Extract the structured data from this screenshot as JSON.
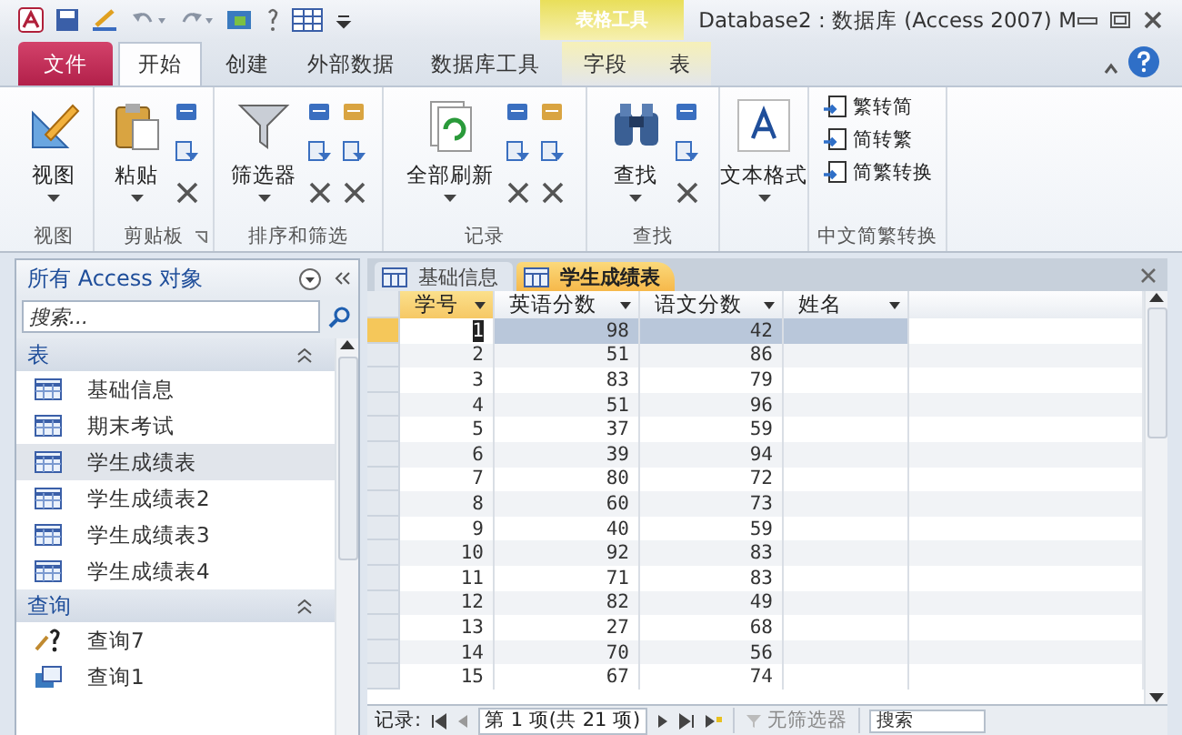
{
  "window": {
    "title": "Database2 : 数据库 (Access 2007) M",
    "context_group": "表格工具"
  },
  "ribbon_tabs": [
    {
      "label": "文件",
      "kind": "file",
      "selected": false
    },
    {
      "label": "开始",
      "kind": "normal",
      "selected": true
    },
    {
      "label": "创建",
      "kind": "normal",
      "selected": false
    },
    {
      "label": "外部数据",
      "kind": "normal",
      "selected": false
    },
    {
      "label": "数据库工具",
      "kind": "normal",
      "selected": false
    },
    {
      "label": "字段",
      "kind": "context",
      "selected": false
    },
    {
      "label": "表",
      "kind": "context",
      "selected": false
    }
  ],
  "ribbon_groups": [
    {
      "label": "视图",
      "kind": "view",
      "buttons": [
        "视图"
      ]
    },
    {
      "label": "剪贴板",
      "kind": "clipboard",
      "buttons": [
        "粘贴"
      ]
    },
    {
      "label": "排序和筛选",
      "kind": "sort",
      "buttons": [
        "筛选器"
      ]
    },
    {
      "label": "记录",
      "kind": "records",
      "buttons": [
        "全部刷新"
      ]
    },
    {
      "label": "查找",
      "kind": "find",
      "buttons": [
        "查找"
      ]
    },
    {
      "kind": "format",
      "buttons": [
        "文本格式"
      ]
    },
    {
      "label": "中文简繁转换",
      "kind": "convert",
      "items": [
        "繁转简",
        "简转繁",
        "简繁转换"
      ]
    }
  ],
  "navigation": {
    "title": "所有 Access 对象",
    "search_placeholder": "搜索...",
    "sections": [
      {
        "label": "表",
        "expanded": true,
        "items": [
          {
            "label": "基础信息",
            "kind": "table",
            "selected": false
          },
          {
            "label": "期末考试",
            "kind": "table",
            "selected": false
          },
          {
            "label": "学生成绩表",
            "kind": "table",
            "selected": true
          },
          {
            "label": "学生成绩表2",
            "kind": "table",
            "selected": false
          },
          {
            "label": "学生成绩表3",
            "kind": "table",
            "selected": false
          },
          {
            "label": "学生成绩表4",
            "kind": "table",
            "selected": false
          }
        ]
      },
      {
        "label": "查询",
        "expanded": true,
        "items": [
          {
            "label": "查询7",
            "kind": "parameter_query",
            "selected": false
          },
          {
            "label": "查询1",
            "kind": "query",
            "selected": false
          }
        ]
      }
    ]
  },
  "document_tabs": [
    {
      "label": "基础信息",
      "selected": false
    },
    {
      "label": "学生成绩表",
      "selected": true
    }
  ],
  "table": {
    "columns": [
      "学号",
      "英语分数",
      "语文分数",
      "姓名"
    ],
    "rows": [
      {
        "cells": [
          "1",
          "98",
          "42"
        ],
        "selected": true
      },
      {
        "cells": [
          "2",
          "51",
          "86"
        ],
        "selected": false
      },
      {
        "cells": [
          "3",
          "83",
          "79"
        ],
        "selected": false
      },
      {
        "cells": [
          "4",
          "51",
          "96"
        ],
        "selected": false
      },
      {
        "cells": [
          "5",
          "37",
          "59"
        ],
        "selected": false
      },
      {
        "cells": [
          "6",
          "39",
          "94"
        ],
        "selected": false
      },
      {
        "cells": [
          "7",
          "80",
          "72"
        ],
        "selected": false
      },
      {
        "cells": [
          "8",
          "60",
          "73"
        ],
        "selected": false
      },
      {
        "cells": [
          "9",
          "40",
          "59"
        ],
        "selected": false
      },
      {
        "cells": [
          "10",
          "92",
          "83"
        ],
        "selected": false
      },
      {
        "cells": [
          "11",
          "71",
          "83"
        ],
        "selected": false
      },
      {
        "cells": [
          "12",
          "82",
          "49"
        ],
        "selected": false
      },
      {
        "cells": [
          "13",
          "27",
          "68"
        ],
        "selected": false
      },
      {
        "cells": [
          "14",
          "70",
          "56"
        ],
        "selected": false
      },
      {
        "cells": [
          "15",
          "67",
          "74"
        ],
        "selected": false
      }
    ]
  },
  "status_bar": {
    "label": "记录:",
    "position": "第 1 项(共 21 项)",
    "filter": "无筛选器",
    "search_placeholder": "搜索"
  }
}
